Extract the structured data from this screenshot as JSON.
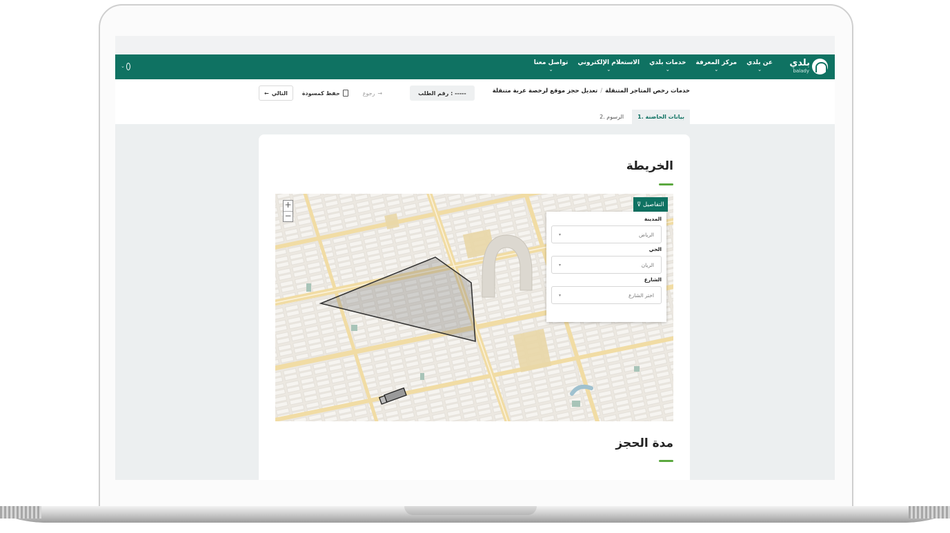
{
  "nav": {
    "logo_text": "بلدي",
    "logo_sub": "balady",
    "items": [
      {
        "label": "عن بلدي"
      },
      {
        "label": "مركز المعرفة"
      },
      {
        "label": "خدمات بلدي"
      },
      {
        "label": "الاستعلام الإلكتروني"
      },
      {
        "label": "تواصل معنا"
      }
    ],
    "caret": "⌄"
  },
  "breadcrumb": {
    "parent": "خدمات رخص المتاجر المتنقلة",
    "separator": "/",
    "current": "تعديل حجز موقع لرخصة عربة متنقلة"
  },
  "actions": {
    "next_label": "التالي",
    "next_icon": "←",
    "draft_label": "حفظ كمسودة",
    "back_label": "رجوع",
    "back_icon": "→",
    "request_number": "رقم الطلب : -----"
  },
  "tabs": [
    {
      "label": "1. بيانات الحاضنة",
      "active": true
    },
    {
      "label": "2. الرسوم",
      "active": false
    }
  ],
  "sections": {
    "map_title": "الخريطة",
    "duration_title": "مدة الحجز"
  },
  "map": {
    "zoom_in": "+",
    "zoom_out": "−",
    "filter_toggle": "التفاصيل ⊽",
    "city_label": "المدينة",
    "city_value": "الرياض",
    "district_label": "الحي",
    "district_value": "الريان",
    "street_label": "الشارع",
    "street_placeholder": "اختر الشارع",
    "select_caret": "▾"
  },
  "colors": {
    "brand_green": "#0f7262",
    "accent_green": "#5ba83f"
  }
}
